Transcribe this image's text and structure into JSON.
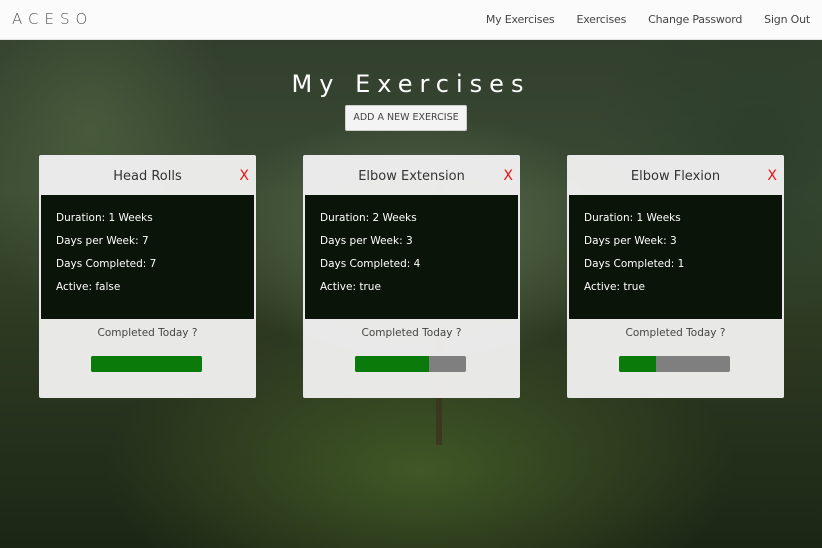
{
  "nav": {
    "logo": "ACESO",
    "links": [
      "My Exercises",
      "Exercises",
      "Change Password",
      "Sign Out"
    ]
  },
  "page": {
    "title": "My Exercises",
    "add_button": "ADD A NEW EXERCISE"
  },
  "cards": [
    {
      "title": "Head Rolls",
      "close_label": "X",
      "duration": "Duration: 1 Weeks",
      "days_per_week": "Days per Week: 7",
      "days_completed": "Days Completed: 7",
      "active": "Active: false",
      "completed_today": "Completed Today ?",
      "progress": 1.0
    },
    {
      "title": "Elbow Extension",
      "close_label": "X",
      "duration": "Duration: 2 Weeks",
      "days_per_week": "Days per Week: 3",
      "days_completed": "Days Completed: 4",
      "active": "Active: true",
      "completed_today": "Completed Today ?",
      "progress": 0.667
    },
    {
      "title": "Elbow Flexion",
      "close_label": "X",
      "duration": "Duration: 1 Weeks",
      "days_per_week": "Days per Week: 3",
      "days_completed": "Days Completed: 1",
      "active": "Active: true",
      "completed_today": "Completed Today ?",
      "progress": 0.333
    }
  ],
  "colors": {
    "progress_fill": "#0a7a0a",
    "progress_track": "#7f7f7f",
    "close": "#ee1111"
  }
}
